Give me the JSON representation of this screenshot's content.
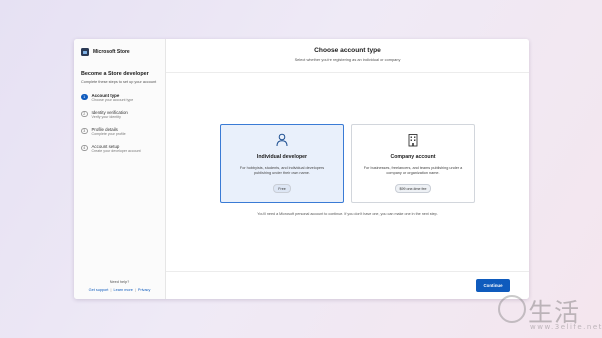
{
  "app": {
    "name": "Microsoft Store"
  },
  "sidebar": {
    "title": "Become a Store developer",
    "subtitle": "Complete these steps to set up your account",
    "steps": [
      {
        "num": "1",
        "title": "Account type",
        "desc": "Choose your account type",
        "active": true
      },
      {
        "num": "2",
        "title": "Identity verification",
        "desc": "Verify your identity",
        "active": false
      },
      {
        "num": "3",
        "title": "Profile details",
        "desc": "Complete your profile",
        "active": false
      },
      {
        "num": "4",
        "title": "Account setup",
        "desc": "Create your developer account",
        "active": false
      }
    ],
    "footer": {
      "help": "Need help?",
      "links": [
        "Get support",
        "Learn more",
        "Privacy"
      ],
      "separator": "|"
    }
  },
  "main": {
    "title": "Choose account type",
    "subtitle": "Select whether you're registering as an individual or company",
    "cards": [
      {
        "title": "Individual developer",
        "desc": "For hobbyists, students, and individual developers publishing under their own name.",
        "badge": "Free",
        "icon": "person-icon",
        "selected": true
      },
      {
        "title": "Company account",
        "desc": "For businesses, freelancers, and teams publishing under a company or organization name.",
        "badge": "$99 one-time fee",
        "icon": "building-icon",
        "selected": false
      }
    ],
    "note": "You'll need a Microsoft personal account to continue. If you don't have one, you can make one in the next step.",
    "continue_label": "Continue"
  },
  "watermark": {
    "glyph": "生活",
    "url": "www.3elife.net"
  },
  "colors": {
    "accent": "#0f5bbd",
    "selected_bg": "#e9f0fb",
    "selected_border": "#3a7bd5"
  }
}
